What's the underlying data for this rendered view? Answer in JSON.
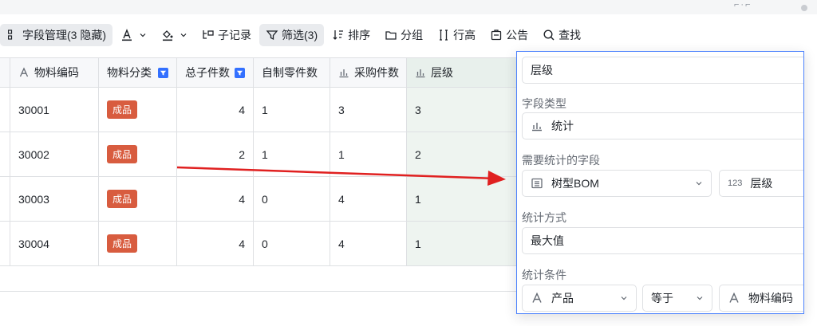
{
  "toolbar": {
    "fields": "字段管理(3 隐藏)",
    "subrecord": "子记录",
    "filter": "筛选(3)",
    "sort": "排序",
    "group": "分组",
    "rowheight": "行高",
    "notice": "公告",
    "find": "查找"
  },
  "table": {
    "headers": [
      "物料编码",
      "物料分类",
      "总子件数",
      "自制零件数",
      "采购件数",
      "层级"
    ],
    "rows": [
      {
        "code": "30001",
        "category": "成品",
        "total": "4",
        "self": "1",
        "purchase": "3",
        "level": "3"
      },
      {
        "code": "30002",
        "category": "成品",
        "total": "2",
        "self": "1",
        "purchase": "1",
        "level": "2"
      },
      {
        "code": "30003",
        "category": "成品",
        "total": "4",
        "self": "0",
        "purchase": "4",
        "level": "1"
      },
      {
        "code": "30004",
        "category": "成品",
        "total": "4",
        "self": "0",
        "purchase": "4",
        "level": "1"
      }
    ]
  },
  "panel": {
    "name_value": "层级",
    "type_label": "字段类型",
    "type_value": "统计",
    "field_label": "需要统计的字段",
    "field_source": "树型BOM",
    "field_num_prefix": "123",
    "field_target": "层级",
    "method_label": "统计方式",
    "method_value": "最大值",
    "cond_label": "统计条件",
    "cond_field": "产品",
    "cond_op": "等于",
    "cond_value": "物料编码"
  },
  "colors": {
    "accent": "#3370ff",
    "tag": "#d85c3f",
    "arrow": "#e02020",
    "highlight": "#eef4f0"
  }
}
